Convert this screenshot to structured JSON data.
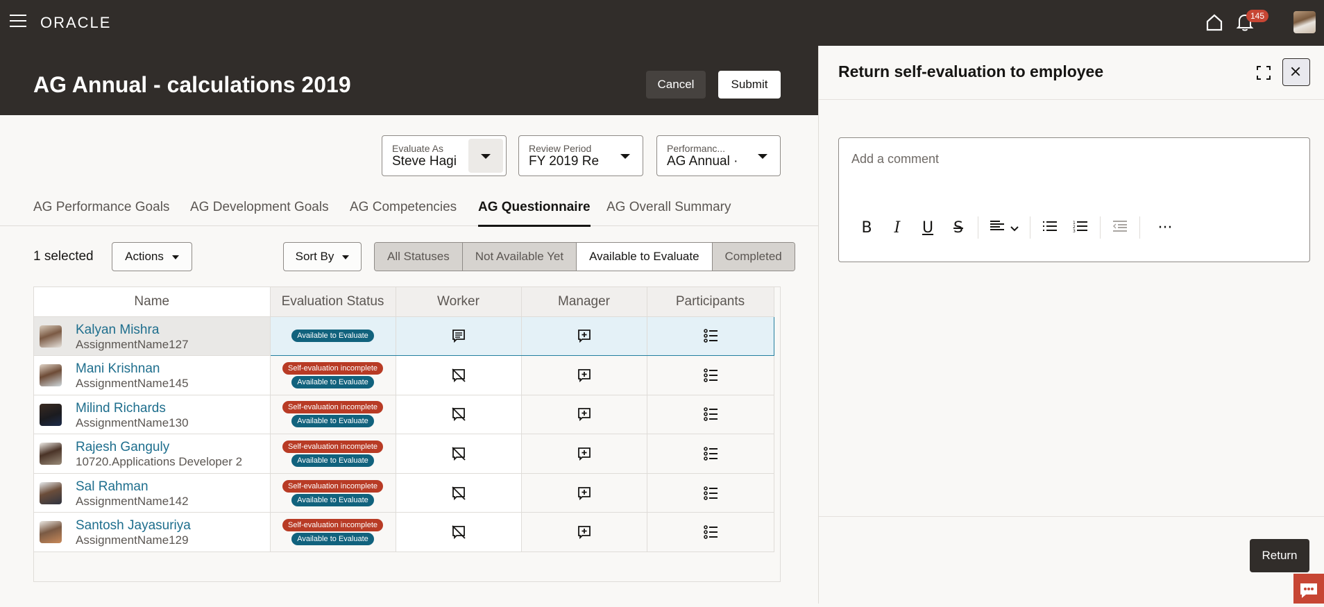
{
  "topbar": {
    "logo": "ORACLE",
    "notifications_count": "145",
    "icons": [
      "menu-icon",
      "home-icon",
      "bell-icon",
      "user-avatar"
    ]
  },
  "header": {
    "title": "AG Annual - calculations 2019",
    "cancel_label": "Cancel",
    "submit_label": "Submit"
  },
  "filters": [
    {
      "label": "Evaluate As",
      "value": "Steve Hagi"
    },
    {
      "label": "Review Period",
      "value": "FY 2019 Re"
    },
    {
      "label": "Performanc...",
      "value": "AG Annual ·"
    }
  ],
  "tabs": [
    {
      "label": "AG Performance Goals",
      "active": false
    },
    {
      "label": "AG Development Goals",
      "active": false
    },
    {
      "label": "AG Competencies",
      "active": false
    },
    {
      "label": "AG Questionnaire",
      "active": true
    },
    {
      "label": "AG Overall Summary",
      "active": false
    }
  ],
  "toolbar": {
    "selected_text": "1 selected",
    "actions_label": "Actions",
    "sort_label": "Sort By",
    "status_filters": [
      {
        "label": "All Statuses",
        "active": false
      },
      {
        "label": "Not Available Yet",
        "active": false
      },
      {
        "label": "Available to Evaluate",
        "active": true
      },
      {
        "label": "Completed",
        "active": false
      }
    ]
  },
  "table": {
    "columns": [
      "Name",
      "Evaluation Status",
      "Worker",
      "Manager",
      "Participants"
    ],
    "rows": [
      {
        "name": "Kalyan Mishra",
        "assignment": "AssignmentName127",
        "statuses": [
          "Available to Evaluate"
        ],
        "worker_icon": "comment-icon",
        "selected": true
      },
      {
        "name": "Mani Krishnan",
        "assignment": "AssignmentName145",
        "statuses": [
          "Self-evaluation incomplete",
          "Available to Evaluate"
        ],
        "worker_icon": "comment-off-icon",
        "selected": false
      },
      {
        "name": "Milind Richards",
        "assignment": "AssignmentName130",
        "statuses": [
          "Self-evaluation incomplete",
          "Available to Evaluate"
        ],
        "worker_icon": "comment-off-icon",
        "selected": false
      },
      {
        "name": "Rajesh Ganguly",
        "assignment": "10720.Applications Developer 2",
        "statuses": [
          "Self-evaluation incomplete",
          "Available to Evaluate"
        ],
        "worker_icon": "comment-off-icon",
        "selected": false
      },
      {
        "name": "Sal Rahman",
        "assignment": "AssignmentName142",
        "statuses": [
          "Self-evaluation incomplete",
          "Available to Evaluate"
        ],
        "worker_icon": "comment-off-icon",
        "selected": false
      },
      {
        "name": "Santosh Jayasuriya",
        "assignment": "AssignmentName129",
        "statuses": [
          "Self-evaluation incomplete",
          "Available to Evaluate"
        ],
        "worker_icon": "comment-off-icon",
        "selected": false
      }
    ]
  },
  "panel": {
    "title": "Return self-evaluation to employee",
    "comment_placeholder": "Add a comment",
    "comment_value": "",
    "return_label": "Return"
  },
  "colors": {
    "brand_dark": "#312d2a",
    "link": "#1e6e8d",
    "status_blue": "#11627d",
    "status_red": "#b83b25",
    "badge": "#c74634"
  }
}
